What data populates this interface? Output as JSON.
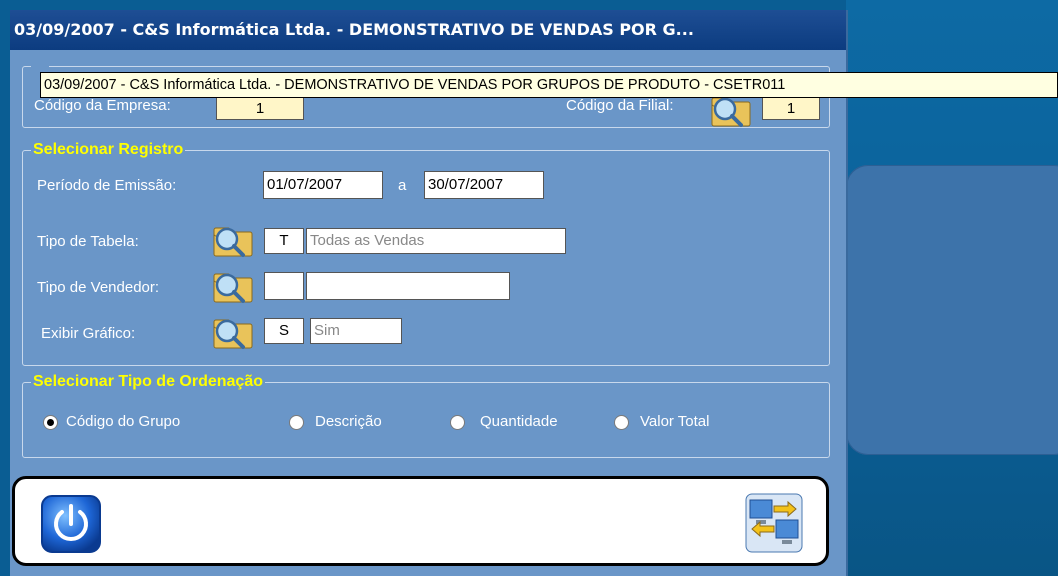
{
  "window": {
    "title": "03/09/2007  -  C&S Informática Ltda.  -  DEMONSTRATIVO DE VENDAS POR G..."
  },
  "tooltip": {
    "text": "03/09/2007  -  C&S Informática Ltda.  -  DEMONSTRATIVO DE VENDAS POR GRUPOS DE PRODUTO  -  CSETR011"
  },
  "empresa": {
    "empresa_label": "Código da Empresa:",
    "empresa_value": "1",
    "filial_label": "Código da Filial:",
    "filial_value": "1"
  },
  "registro": {
    "title": "Selecionar Registro",
    "periodo_label": "Período de Emissão:",
    "data_inicio": "01/07/2007",
    "separador": "a",
    "data_fim": "30/07/2007",
    "tipo_tabela_label": "Tipo de Tabela:",
    "tipo_tabela_code": "T",
    "tipo_tabela_desc": "Todas as Vendas",
    "tipo_vendedor_label": "Tipo de Vendedor:",
    "tipo_vendedor_code": "",
    "tipo_vendedor_desc": "",
    "grafico_label": "Exibir Gráfico:",
    "grafico_code": "S",
    "grafico_desc": "Sim"
  },
  "ordenacao": {
    "title": "Selecionar Tipo de Ordenação",
    "options": [
      "Código do Grupo",
      "Descrição",
      "Quantidade",
      "Valor Total"
    ],
    "selected": "Código do Grupo"
  },
  "icons": {
    "search": "folder-search-icon",
    "exit": "power-icon",
    "execute": "computer-transfer-icon"
  },
  "colors": {
    "background": "#0a5d93",
    "window": "#6a96c8",
    "titlebar": "#0c3c80",
    "group_title": "#ffff00",
    "tooltip": "#ffffe1"
  }
}
